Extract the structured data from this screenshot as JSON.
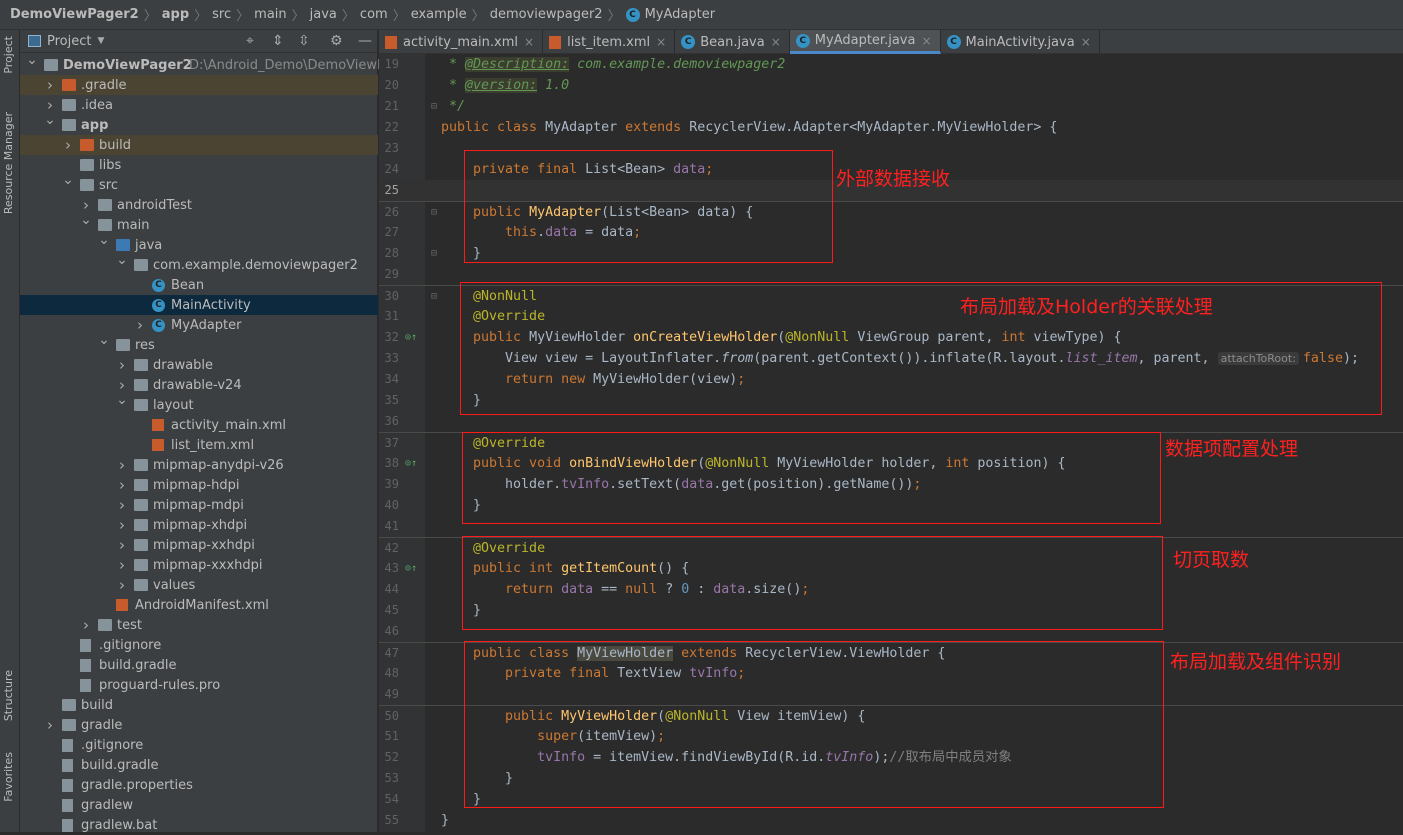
{
  "breadcrumb": {
    "items": [
      "DemoViewPager2",
      "app",
      "src",
      "main",
      "java",
      "com",
      "example",
      "demoviewpager2",
      "MyAdapter"
    ]
  },
  "side_strip": {
    "top": [
      "Project",
      "Resource Manager"
    ],
    "bottom": [
      "Structure",
      "Favorites"
    ]
  },
  "project_panel": {
    "title": "Project",
    "root_path": "D:\\Android_Demo\\DemoViewPage",
    "tree": [
      {
        "label": "DemoViewPager2",
        "depth": 0,
        "arrow": "open",
        "icon": "module",
        "bold": true
      },
      {
        "label": ".gradle",
        "depth": 1,
        "arrow": "closed",
        "icon": "folder-orange",
        "state": "excluded"
      },
      {
        "label": ".idea",
        "depth": 1,
        "arrow": "closed",
        "icon": "folder"
      },
      {
        "label": "app",
        "depth": 1,
        "arrow": "open",
        "icon": "module",
        "bold": true
      },
      {
        "label": "build",
        "depth": 2,
        "arrow": "closed",
        "icon": "folder-orange",
        "state": "excluded"
      },
      {
        "label": "libs",
        "depth": 2,
        "icon": "folder"
      },
      {
        "label": "src",
        "depth": 2,
        "arrow": "open",
        "icon": "folder"
      },
      {
        "label": "androidTest",
        "depth": 3,
        "arrow": "closed",
        "icon": "folder"
      },
      {
        "label": "main",
        "depth": 3,
        "arrow": "open",
        "icon": "folder"
      },
      {
        "label": "java",
        "depth": 4,
        "arrow": "open",
        "icon": "folder-blue"
      },
      {
        "label": "com.example.demoviewpager2",
        "depth": 5,
        "arrow": "open",
        "icon": "folder"
      },
      {
        "label": "Bean",
        "depth": 6,
        "icon": "class"
      },
      {
        "label": "MainActivity",
        "depth": 6,
        "icon": "class",
        "state": "selected"
      },
      {
        "label": "MyAdapter",
        "depth": 6,
        "arrow": "closed",
        "icon": "class"
      },
      {
        "label": "res",
        "depth": 4,
        "arrow": "open",
        "icon": "folder"
      },
      {
        "label": "drawable",
        "depth": 5,
        "arrow": "closed",
        "icon": "folder"
      },
      {
        "label": "drawable-v24",
        "depth": 5,
        "arrow": "closed",
        "icon": "folder"
      },
      {
        "label": "layout",
        "depth": 5,
        "arrow": "open",
        "icon": "folder"
      },
      {
        "label": "activity_main.xml",
        "depth": 6,
        "icon": "xml"
      },
      {
        "label": "list_item.xml",
        "depth": 6,
        "icon": "xml"
      },
      {
        "label": "mipmap-anydpi-v26",
        "depth": 5,
        "arrow": "closed",
        "icon": "folder"
      },
      {
        "label": "mipmap-hdpi",
        "depth": 5,
        "arrow": "closed",
        "icon": "folder"
      },
      {
        "label": "mipmap-mdpi",
        "depth": 5,
        "arrow": "closed",
        "icon": "folder"
      },
      {
        "label": "mipmap-xhdpi",
        "depth": 5,
        "arrow": "closed",
        "icon": "folder"
      },
      {
        "label": "mipmap-xxhdpi",
        "depth": 5,
        "arrow": "closed",
        "icon": "folder"
      },
      {
        "label": "mipmap-xxxhdpi",
        "depth": 5,
        "arrow": "closed",
        "icon": "folder"
      },
      {
        "label": "values",
        "depth": 5,
        "arrow": "closed",
        "icon": "folder"
      },
      {
        "label": "AndroidManifest.xml",
        "depth": 4,
        "icon": "manifest"
      },
      {
        "label": "test",
        "depth": 3,
        "arrow": "closed",
        "icon": "folder"
      },
      {
        "label": ".gitignore",
        "depth": 2,
        "icon": "file"
      },
      {
        "label": "build.gradle",
        "depth": 2,
        "icon": "gradle"
      },
      {
        "label": "proguard-rules.pro",
        "depth": 2,
        "icon": "file"
      },
      {
        "label": "build",
        "depth": 1,
        "icon": "folder"
      },
      {
        "label": "gradle",
        "depth": 1,
        "arrow": "closed",
        "icon": "folder"
      },
      {
        "label": ".gitignore",
        "depth": 1,
        "icon": "file"
      },
      {
        "label": "build.gradle",
        "depth": 1,
        "icon": "gradle"
      },
      {
        "label": "gradle.properties",
        "depth": 1,
        "icon": "gradle"
      },
      {
        "label": "gradlew",
        "depth": 1,
        "icon": "file"
      },
      {
        "label": "gradlew.bat",
        "depth": 1,
        "icon": "file"
      }
    ]
  },
  "tabs": [
    {
      "label": "activity_main.xml",
      "icon": "xml"
    },
    {
      "label": "list_item.xml",
      "icon": "xml"
    },
    {
      "label": "Bean.java",
      "icon": "class"
    },
    {
      "label": "MyAdapter.java",
      "icon": "class",
      "active": true
    },
    {
      "label": "MainActivity.java",
      "icon": "class"
    }
  ],
  "editor": {
    "current_line": 25,
    "lines": [
      {
        "n": 19,
        "t": [
          [
            " * ",
            "d"
          ],
          [
            "@Description:",
            "dt"
          ],
          [
            " com.example.demoviewpager2",
            "d"
          ]
        ]
      },
      {
        "n": 20,
        "t": [
          [
            " * ",
            "d"
          ],
          [
            "@version:",
            "dt"
          ],
          [
            " 1.0",
            "d"
          ]
        ]
      },
      {
        "n": 21,
        "t": [
          [
            " */",
            "d"
          ]
        ],
        "fold": true
      },
      {
        "n": 22,
        "t": [
          [
            "public class ",
            "k"
          ],
          [
            "MyAdapter ",
            "t"
          ],
          [
            "extends ",
            "k"
          ],
          [
            "RecyclerView.Adapter<MyAdapter.MyViewHolder> {",
            "t"
          ]
        ]
      },
      {
        "n": 23,
        "t": []
      },
      {
        "n": 24,
        "t": [
          [
            "    private final ",
            "k"
          ],
          [
            "List<Bean> ",
            "t"
          ],
          [
            "data",
            "f"
          ],
          [
            ";",
            "k"
          ]
        ]
      },
      {
        "n": 25,
        "t": []
      },
      {
        "n": 26,
        "t": [
          [
            "    public ",
            "k"
          ],
          [
            "MyAdapter",
            "m"
          ],
          [
            "(List<Bean> data) {",
            "t"
          ]
        ],
        "fold": true,
        "sep": true
      },
      {
        "n": 27,
        "t": [
          [
            "        this",
            "k"
          ],
          [
            ".",
            "t"
          ],
          [
            "data",
            "f"
          ],
          [
            " = data",
            "t"
          ],
          [
            ";",
            "k"
          ]
        ]
      },
      {
        "n": 28,
        "t": [
          [
            "    }",
            "t"
          ]
        ],
        "fold": true
      },
      {
        "n": 29,
        "t": []
      },
      {
        "n": 30,
        "t": [
          [
            "    @NonNull",
            "a"
          ]
        ],
        "fold": true,
        "sep": true
      },
      {
        "n": 31,
        "t": [
          [
            "    @Override",
            "a"
          ]
        ]
      },
      {
        "n": 32,
        "t": [
          [
            "    public ",
            "k"
          ],
          [
            "MyViewHolder ",
            "t"
          ],
          [
            "onCreateViewHolder",
            "m"
          ],
          [
            "(",
            "t"
          ],
          [
            "@NonNull ",
            "a"
          ],
          [
            "ViewGroup parent, ",
            "t"
          ],
          [
            "int ",
            "k"
          ],
          [
            "viewType) {",
            "t"
          ]
        ],
        "override": true
      },
      {
        "n": 33,
        "t": [
          [
            "        View view = LayoutInflater.",
            "t"
          ],
          [
            "from",
            "mi"
          ],
          [
            "(parent.getContext()).inflate(R.layout.",
            "t"
          ],
          [
            "list_item",
            "fi"
          ],
          [
            ", parent, ",
            "t"
          ],
          [
            "attachToRoot:",
            "hint"
          ],
          [
            "false",
            "k"
          ],
          [
            ");",
            "t"
          ]
        ]
      },
      {
        "n": 34,
        "t": [
          [
            "        return new ",
            "k"
          ],
          [
            "MyViewHolder(view)",
            "t"
          ],
          [
            ";",
            "k"
          ]
        ]
      },
      {
        "n": 35,
        "t": [
          [
            "    }",
            "t"
          ]
        ]
      },
      {
        "n": 36,
        "t": []
      },
      {
        "n": 37,
        "t": [
          [
            "    @Override",
            "a"
          ]
        ],
        "sep": true
      },
      {
        "n": 38,
        "t": [
          [
            "    public void ",
            "k"
          ],
          [
            "onBindViewHolder",
            "m"
          ],
          [
            "(",
            "t"
          ],
          [
            "@NonNull ",
            "a"
          ],
          [
            "MyViewHolder holder, ",
            "t"
          ],
          [
            "int ",
            "k"
          ],
          [
            "position) {",
            "t"
          ]
        ],
        "override": true
      },
      {
        "n": 39,
        "t": [
          [
            "        holder.",
            "t"
          ],
          [
            "tvInfo",
            "f"
          ],
          [
            ".setText(",
            "t"
          ],
          [
            "data",
            "f"
          ],
          [
            ".get(position).getName())",
            "t"
          ],
          [
            ";",
            "k"
          ]
        ]
      },
      {
        "n": 40,
        "t": [
          [
            "    }",
            "t"
          ]
        ]
      },
      {
        "n": 41,
        "t": []
      },
      {
        "n": 42,
        "t": [
          [
            "    @Override",
            "a"
          ]
        ],
        "sep": true
      },
      {
        "n": 43,
        "t": [
          [
            "    public int ",
            "k"
          ],
          [
            "getItemCount",
            "m"
          ],
          [
            "() {",
            "t"
          ]
        ],
        "override": true
      },
      {
        "n": 44,
        "t": [
          [
            "        return ",
            "k"
          ],
          [
            "data",
            "f"
          ],
          [
            " == ",
            "t"
          ],
          [
            "null ",
            "k"
          ],
          [
            "? ",
            "t"
          ],
          [
            "0",
            "n"
          ],
          [
            " : ",
            "t"
          ],
          [
            "data",
            "f"
          ],
          [
            ".size()",
            "t"
          ],
          [
            ";",
            "k"
          ]
        ]
      },
      {
        "n": 45,
        "t": [
          [
            "    }",
            "t"
          ]
        ]
      },
      {
        "n": 46,
        "t": []
      },
      {
        "n": 47,
        "t": [
          [
            "    public class ",
            "k"
          ],
          [
            "MyViewHolder",
            "hlw"
          ],
          [
            " extends ",
            "k"
          ],
          [
            "RecyclerView.ViewHolder {",
            "t"
          ]
        ],
        "sep": true
      },
      {
        "n": 48,
        "t": [
          [
            "        private final ",
            "k"
          ],
          [
            "TextView ",
            "t"
          ],
          [
            "tvInfo",
            "f"
          ],
          [
            ";",
            "k"
          ]
        ]
      },
      {
        "n": 49,
        "t": []
      },
      {
        "n": 50,
        "t": [
          [
            "        public ",
            "k"
          ],
          [
            "MyViewHolder",
            "m"
          ],
          [
            "(",
            "t"
          ],
          [
            "@NonNull ",
            "a"
          ],
          [
            "View itemView) {",
            "t"
          ]
        ],
        "sep": true
      },
      {
        "n": 51,
        "t": [
          [
            "            super",
            "k"
          ],
          [
            "(itemView)",
            "t"
          ],
          [
            ";",
            "k"
          ]
        ]
      },
      {
        "n": 52,
        "t": [
          [
            "            tvInfo",
            "f"
          ],
          [
            " = itemView.findViewById(R.id.",
            "t"
          ],
          [
            "tvInfo",
            "fi"
          ],
          [
            ");",
            "t"
          ],
          [
            "//取布局中成员对象",
            "cm"
          ]
        ]
      },
      {
        "n": 53,
        "t": [
          [
            "        }",
            "t"
          ]
        ]
      },
      {
        "n": 54,
        "t": [
          [
            "    }",
            "t"
          ]
        ]
      },
      {
        "n": 55,
        "t": [
          [
            "}",
            "t"
          ]
        ]
      }
    ]
  },
  "annotations": [
    {
      "text": "外部数据接收",
      "color": "#ff2020"
    },
    {
      "text": "布局加载及Holder的关联处理",
      "color": "#ff2020"
    },
    {
      "text": "数据项配置处理",
      "color": "#ff2020"
    },
    {
      "text": "切页取数",
      "color": "#ff2020"
    },
    {
      "text": "布局加载及组件识别",
      "color": "#ff2020"
    }
  ]
}
